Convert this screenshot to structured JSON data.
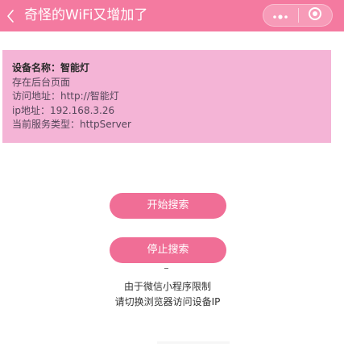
{
  "nav": {
    "title": "奇怪的WiFi又增加了",
    "back_icon": "chevron-left-icon",
    "menu_icon": "more-dots-icon",
    "close_icon": "target-circle-icon"
  },
  "colors": {
    "nav_bg": "#f47aa0",
    "panel_bg": "#f4b4d6",
    "button_bg": "#f06e96"
  },
  "device_info": {
    "name_line": "设备名称：智能灯",
    "storage_line": "存在后台页面",
    "url_line": "访问地址：http://智能灯",
    "ip_line": "ip地址：192.168.3.26",
    "service_line": "当前服务类型：httpServer"
  },
  "actions": {
    "start_label": "开始搜索",
    "stop_label": "停止搜索"
  },
  "notes": {
    "line1": "由于微信小程序限制",
    "line2": "请切换浏览器访问设备IP"
  }
}
